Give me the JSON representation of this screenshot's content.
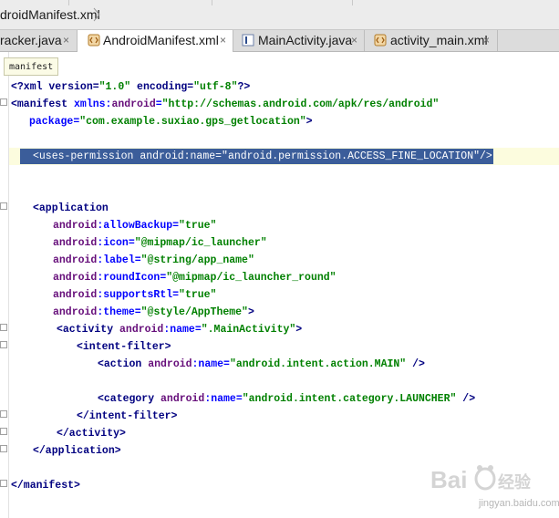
{
  "breadcrumb": {
    "file": "droidManifest.xml"
  },
  "tabs": [
    {
      "label": "racker.java",
      "icon": "java-class-icon",
      "active": false
    },
    {
      "label": "AndroidManifest.xml",
      "icon": "xml-file-icon",
      "active": true
    },
    {
      "label": "MainActivity.java",
      "icon": "java-class-icon",
      "active": false
    },
    {
      "label": "activity_main.xml",
      "icon": "layout-xml-icon",
      "active": false
    }
  ],
  "tab_close_glyph": "×",
  "tooltip": "manifest",
  "code": {
    "l1": {
      "a": "<?xml version=",
      "b": "\"1.0\"",
      "c": " encoding=",
      "d": "\"utf-8\"",
      "e": "?>"
    },
    "l2": {
      "a": "<manifest ",
      "b": "xmlns:",
      "c": "android",
      "d": "=",
      "e": "\"http://schemas.android.com/apk/res/android\""
    },
    "l3": {
      "a": "package",
      "b": "=",
      "c": "\"com.example.suxiao.gps_getlocation\"",
      "d": ">"
    },
    "l4": {
      "a": "<uses-permission android:name=",
      "b": "\"android.permission.ACCESS_FINE_LOCATION\"",
      "c": "/>"
    },
    "l5": {
      "a": "<application"
    },
    "l6": {
      "a": "android",
      "b": ":allowBackup",
      "c": "=",
      "d": "\"true\""
    },
    "l7": {
      "a": "android",
      "b": ":icon",
      "c": "=",
      "d": "\"@mipmap/ic_launcher\""
    },
    "l8": {
      "a": "android",
      "b": ":label",
      "c": "=",
      "d": "\"@string/app_name\""
    },
    "l9": {
      "a": "android",
      "b": ":roundIcon",
      "c": "=",
      "d": "\"@mipmap/ic_launcher_round\""
    },
    "l10": {
      "a": "android",
      "b": ":supportsRtl",
      "c": "=",
      "d": "\"true\""
    },
    "l11": {
      "a": "android",
      "b": ":theme",
      "c": "=",
      "d": "\"@style/AppTheme\"",
      "e": ">"
    },
    "l12": {
      "a": "<activity ",
      "b": "android",
      "c": ":name",
      "d": "=",
      "e": "\".MainActivity\"",
      "f": ">"
    },
    "l13": {
      "a": "<intent-filter>"
    },
    "l14": {
      "a": "<action ",
      "b": "android",
      "c": ":name",
      "d": "=",
      "e": "\"android.intent.action.MAIN\"",
      "f": " />"
    },
    "l15": {
      "a": "<category ",
      "b": "android",
      "c": ":name",
      "d": "=",
      "e": "\"android.intent.category.LAUNCHER\"",
      "f": " />"
    },
    "l16": {
      "a": "</intent-filter>"
    },
    "l17": {
      "a": "</activity>"
    },
    "l18": {
      "a": "</application>"
    },
    "l19": {
      "a": "</manifest>"
    }
  },
  "watermark": {
    "brand": "Baidu经验",
    "url": "jingyan.baidu.com"
  },
  "colors": {
    "tag": "#000080",
    "attribute": "#0000ff",
    "namespace": "#660e7a",
    "value": "#008000",
    "selection": "#3b5d9a",
    "current_line": "#fcfcde"
  }
}
